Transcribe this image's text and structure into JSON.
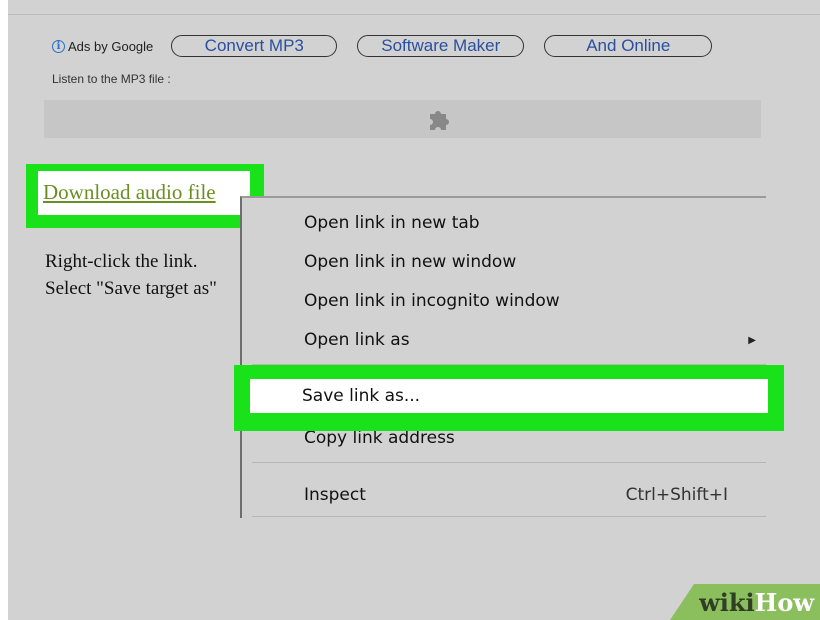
{
  "ads": {
    "info_glyph": "i",
    "label": "Ads by Google",
    "pills": [
      "Convert MP3",
      "Software Maker",
      "And Online"
    ]
  },
  "listen_label": "Listen to the MP3 file :",
  "plugin_icon": "puzzle-icon",
  "download_link": "Download audio file",
  "instructions": {
    "line1": "Right-click the link.",
    "line2": "Select \"Save target as\""
  },
  "context_menu": {
    "items": [
      {
        "label": "Open link in new tab"
      },
      {
        "label": "Open link in new window"
      },
      {
        "label": "Open link in incognito window"
      },
      {
        "label": "Open link as",
        "submenu_arrow": "▶"
      },
      {
        "label": "Save link as..."
      },
      {
        "label": "Copy link address"
      },
      {
        "label": "Inspect",
        "shortcut": "Ctrl+Shift+I"
      }
    ]
  },
  "watermark": {
    "part1": "wiki",
    "part2": "How"
  },
  "colors": {
    "highlight": "#1ae21a",
    "link": "#6b8e23",
    "background": "#d2d2d2"
  }
}
